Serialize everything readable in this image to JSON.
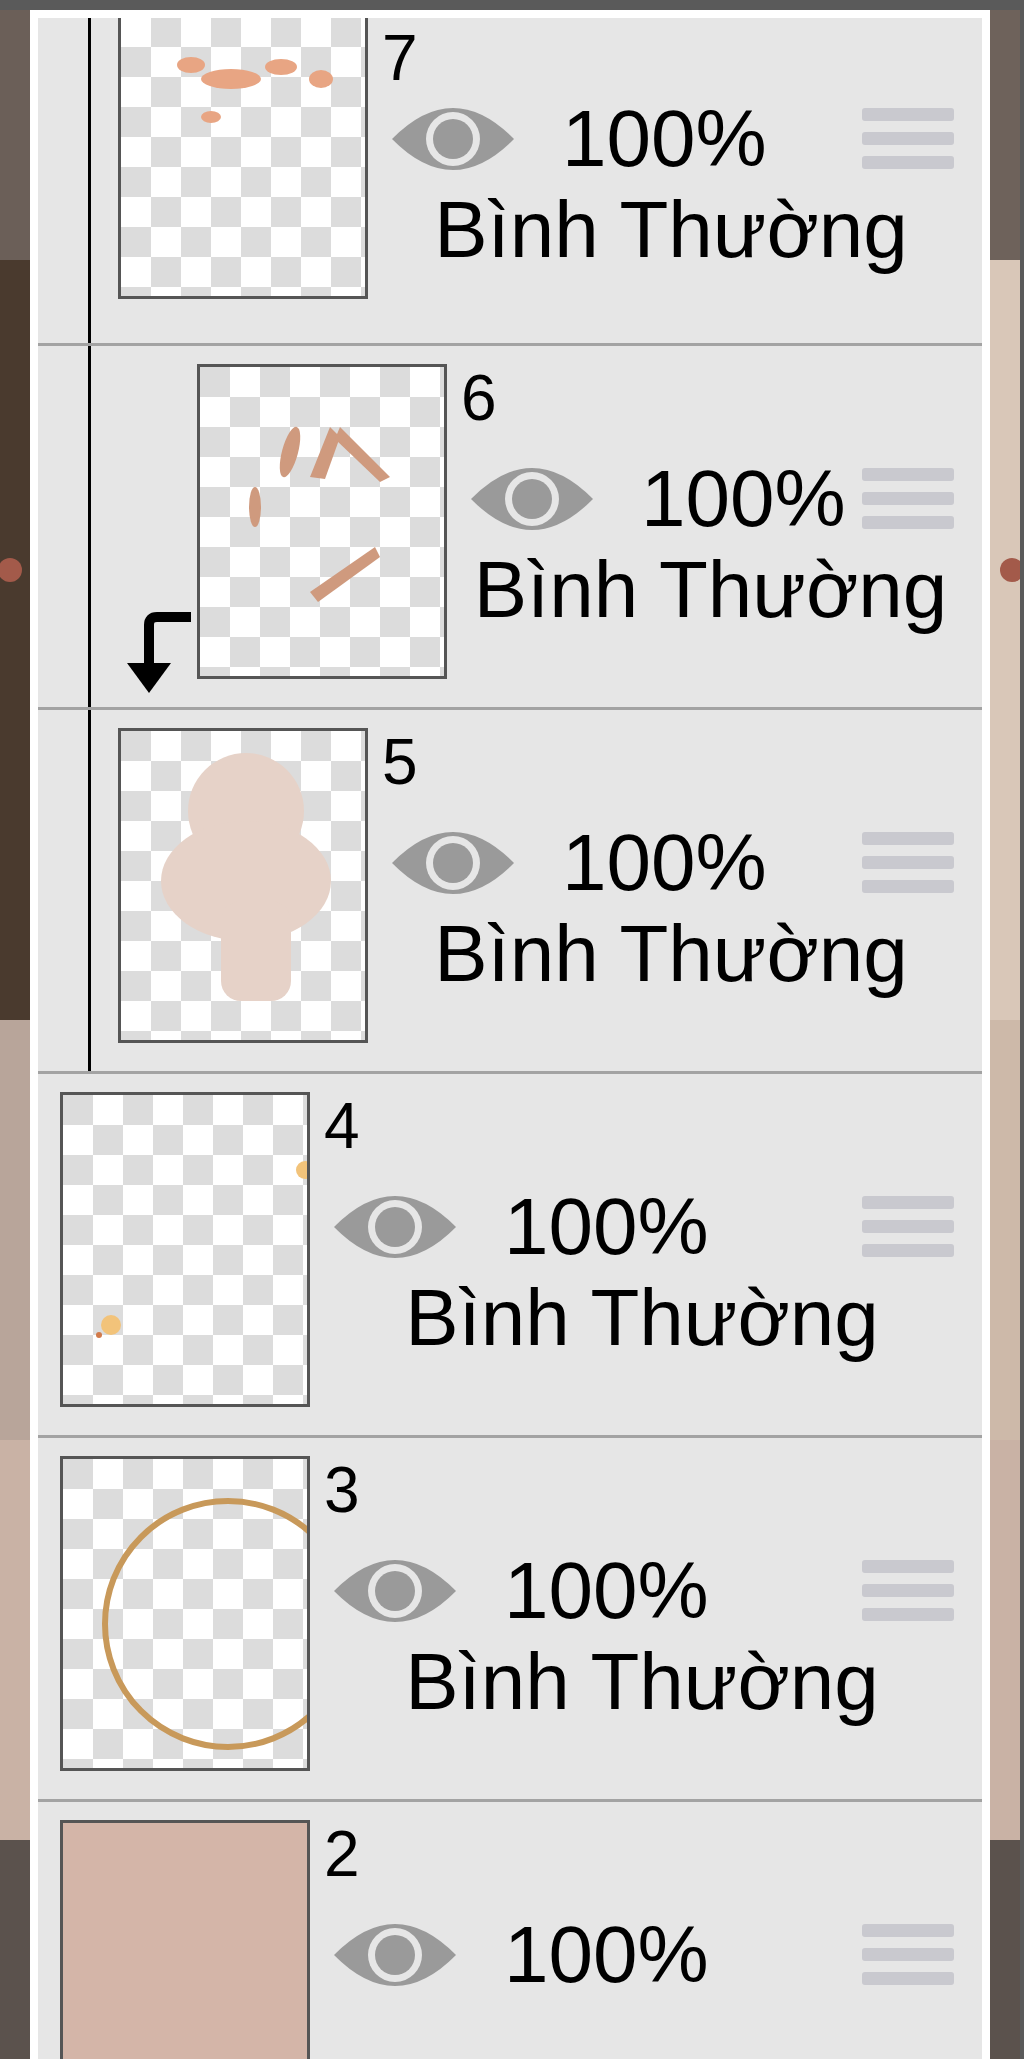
{
  "layers": [
    {
      "number": "7",
      "opacity": "100%",
      "blend_mode": "Bình Thường",
      "visible": true,
      "in_folder": true,
      "clipped": false
    },
    {
      "number": "6",
      "opacity": "100%",
      "blend_mode": "Bình Thường",
      "visible": true,
      "in_folder": true,
      "clipped": true
    },
    {
      "number": "5",
      "opacity": "100%",
      "blend_mode": "Bình Thường",
      "visible": true,
      "in_folder": true,
      "clipped": false
    },
    {
      "number": "4",
      "opacity": "100%",
      "blend_mode": "Bình Thường",
      "visible": true,
      "in_folder": false,
      "clipped": false
    },
    {
      "number": "3",
      "opacity": "100%",
      "blend_mode": "Bình Thường",
      "visible": true,
      "in_folder": false,
      "clipped": false
    },
    {
      "number": "2",
      "opacity": "100%",
      "visible": true,
      "in_folder": false,
      "clipped": false
    }
  ]
}
